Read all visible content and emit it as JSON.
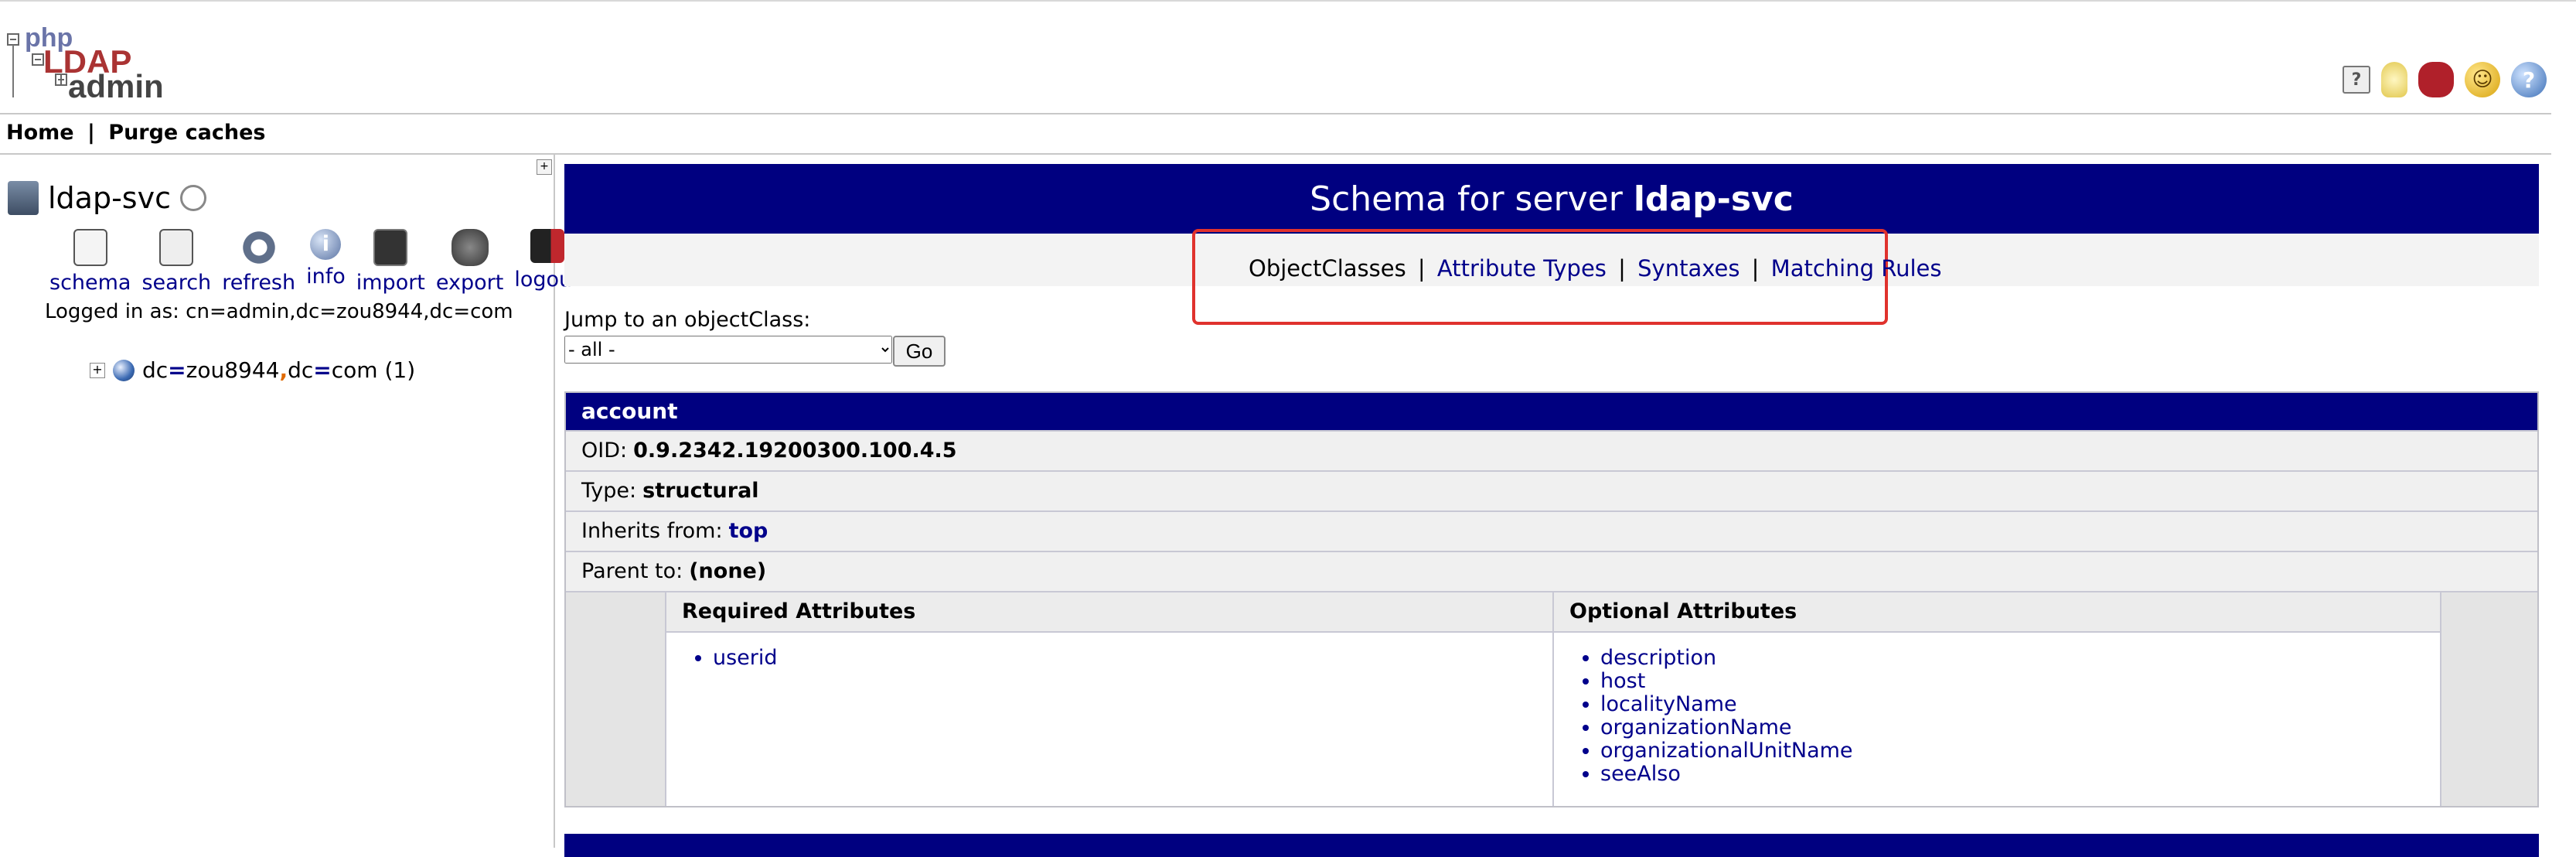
{
  "header": {
    "logo": {
      "line1": "php",
      "line2": "LDAP",
      "line3": "admin"
    },
    "icons": [
      "help-icon",
      "light-bulb-icon",
      "bug-icon",
      "smiley-icon",
      "donate-icon"
    ]
  },
  "menu": {
    "home": "Home",
    "separator": "|",
    "purge": "Purge caches"
  },
  "tree": {
    "server_name": "ldap-svc",
    "tools": [
      {
        "label": "schema",
        "icon": "schema-icon"
      },
      {
        "label": "search",
        "icon": "search-icon"
      },
      {
        "label": "refresh",
        "icon": "refresh-icon"
      },
      {
        "label": "info",
        "icon": "info-icon"
      },
      {
        "label": "import",
        "icon": "import-icon"
      },
      {
        "label": "export",
        "icon": "export-icon"
      },
      {
        "label": "logout",
        "icon": "logout-icon"
      }
    ],
    "logged_in": "Logged in as: cn=admin,dc=zou8944,dc=com",
    "node": {
      "dc1_key": "dc",
      "dc1_val": "zou8944",
      "comma": ",",
      "dc2_key": "dc",
      "dc2_val": "com",
      "count": "(1)",
      "eq": "="
    }
  },
  "main": {
    "title_prefix": "Schema for server",
    "title_server": "ldap-svc",
    "nav": {
      "current": "ObjectClasses",
      "sep": "|",
      "attribute_types": "Attribute Types",
      "syntaxes": "Syntaxes",
      "matching_rules": "Matching Rules"
    },
    "jump_label": "Jump to an objectClass:",
    "jump_selected": "- all -",
    "go_label": "Go",
    "object_class": {
      "name": "account",
      "oid_label": "OID:",
      "oid": "0.9.2342.19200300.100.4.5",
      "type_label": "Type:",
      "type": "structural",
      "inherits_label": "Inherits from:",
      "inherits": "top",
      "parent_label": "Parent to:",
      "parent": "(none)",
      "required_header": "Required Attributes",
      "optional_header": "Optional Attributes",
      "required": [
        "userid"
      ],
      "optional": [
        "description",
        "host",
        "localityName",
        "organizationName",
        "organizationalUnitName",
        "seeAlso"
      ]
    }
  }
}
